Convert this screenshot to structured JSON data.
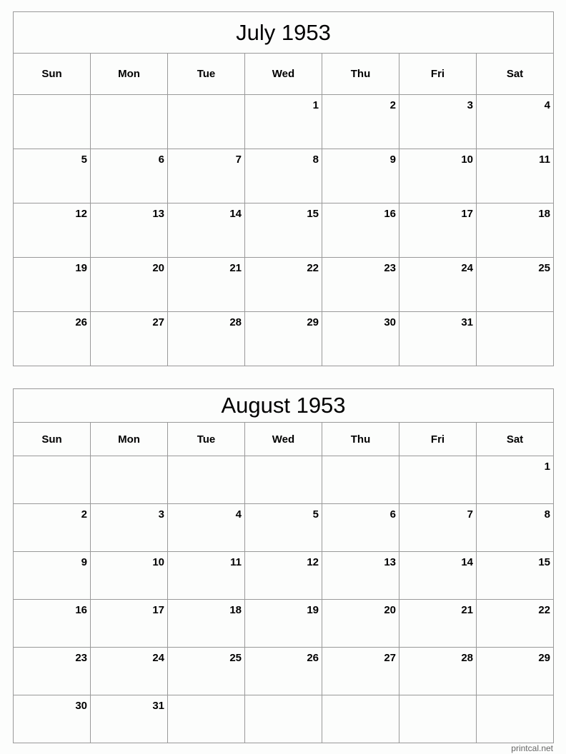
{
  "weekdays": [
    "Sun",
    "Mon",
    "Tue",
    "Wed",
    "Thu",
    "Fri",
    "Sat"
  ],
  "months": [
    {
      "title": "July 1953",
      "weeks": [
        [
          "",
          "",
          "",
          "1",
          "2",
          "3",
          "4"
        ],
        [
          "5",
          "6",
          "7",
          "8",
          "9",
          "10",
          "11"
        ],
        [
          "12",
          "13",
          "14",
          "15",
          "16",
          "17",
          "18"
        ],
        [
          "19",
          "20",
          "21",
          "22",
          "23",
          "24",
          "25"
        ],
        [
          "26",
          "27",
          "28",
          "29",
          "30",
          "31",
          ""
        ]
      ]
    },
    {
      "title": "August 1953",
      "weeks": [
        [
          "",
          "",
          "",
          "",
          "",
          "",
          "1"
        ],
        [
          "2",
          "3",
          "4",
          "5",
          "6",
          "7",
          "8"
        ],
        [
          "9",
          "10",
          "11",
          "12",
          "13",
          "14",
          "15"
        ],
        [
          "16",
          "17",
          "18",
          "19",
          "20",
          "21",
          "22"
        ],
        [
          "23",
          "24",
          "25",
          "26",
          "27",
          "28",
          "29"
        ],
        [
          "30",
          "31",
          "",
          "",
          "",
          "",
          ""
        ]
      ]
    }
  ],
  "footer": "printcal.net",
  "colors": {
    "grid": "#999999",
    "text": "#000000",
    "footer": "#666666"
  }
}
